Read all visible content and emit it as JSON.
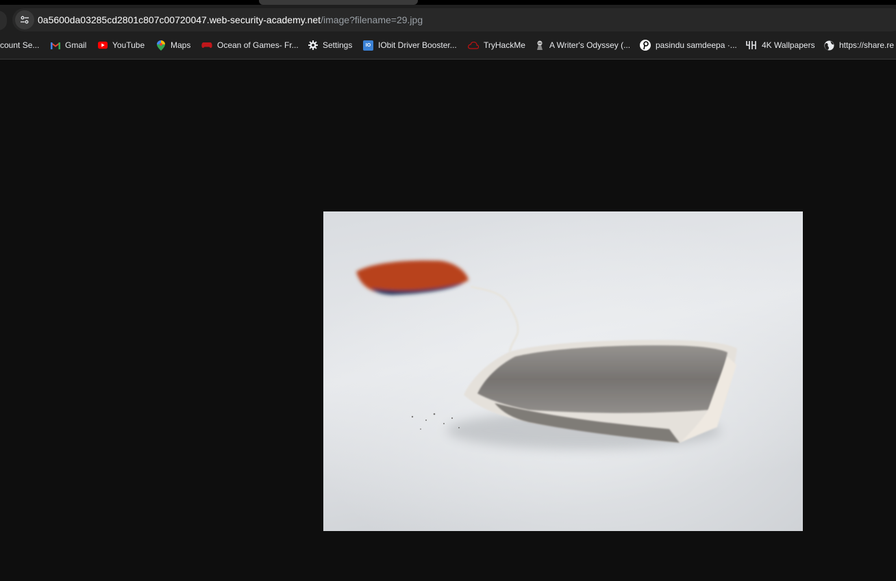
{
  "browser": {
    "address_bar": {
      "host": "0a5600da03285cd2801c807c00720047.web-security-academy.net",
      "path": "/image?filename=29.jpg",
      "icon": "site-settings-icon"
    },
    "bookmarks": [
      {
        "label": "count Se...",
        "icon": "google-account-icon"
      },
      {
        "label": "Gmail",
        "icon": "gmail-icon"
      },
      {
        "label": "YouTube",
        "icon": "youtube-icon"
      },
      {
        "label": "Maps",
        "icon": "maps-pin-icon"
      },
      {
        "label": "Ocean of Games- Fr...",
        "icon": "gamepad-icon"
      },
      {
        "label": "Settings",
        "icon": "gear-icon"
      },
      {
        "label": "IObit Driver Booster...",
        "icon": "iobit-icon"
      },
      {
        "label": "TryHackMe",
        "icon": "tryhackme-icon"
      },
      {
        "label": "A Writer's Odyssey (...",
        "icon": "site-favicon-icon"
      },
      {
        "label": "pasindu samdeepa ·...",
        "icon": "pinterest-icon"
      },
      {
        "label": "4K Wallpapers",
        "icon": "wallpapers-icon"
      },
      {
        "label": "https://share.re",
        "icon": "globe-icon"
      }
    ]
  },
  "viewer": {
    "image": {
      "subject": "tea bag on white surface",
      "background_color": "#0e0e0e"
    }
  },
  "colors": {
    "toolbar": "#1f1f1f",
    "omnibox": "#282828",
    "page_background": "#0e0e0e"
  }
}
